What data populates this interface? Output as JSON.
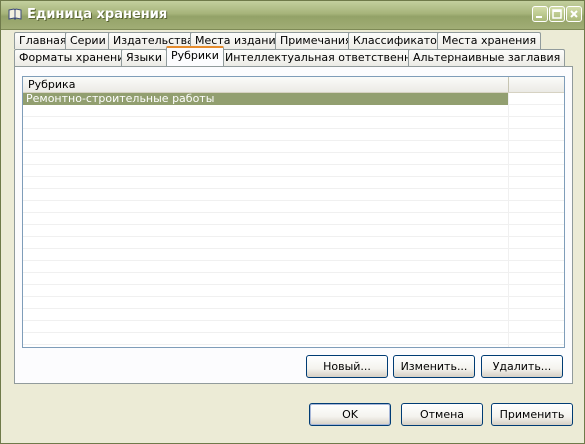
{
  "window": {
    "title": "Единица хранения"
  },
  "tabs_row1": [
    {
      "label": "Главная"
    },
    {
      "label": "Серии"
    },
    {
      "label": "Издательства"
    },
    {
      "label": "Места изданий"
    },
    {
      "label": "Примечания"
    },
    {
      "label": "Классификатор"
    },
    {
      "label": "Места хранения"
    }
  ],
  "tabs_row2": [
    {
      "label": "Форматы хранения"
    },
    {
      "label": "Языки"
    },
    {
      "label": "Рубрики",
      "active": true
    },
    {
      "label": "Интеллектуальная ответственность"
    },
    {
      "label": "Альтернаивные заглавия"
    }
  ],
  "list": {
    "column_header": "Рубрика",
    "rows": [
      {
        "text": "Ремонтно-строительные работы",
        "selected": true
      }
    ]
  },
  "panel_buttons": {
    "new": "Новый...",
    "edit": "Изменить...",
    "delete": "Удалить..."
  },
  "dialog_buttons": {
    "ok": "OK",
    "cancel": "Отмена",
    "apply": "Применить"
  },
  "colors": {
    "titlebar": "#a6b47a",
    "selection": "#929f70",
    "active_tab_accent": "#e68b2c",
    "window_bg": "#ecebd6"
  }
}
